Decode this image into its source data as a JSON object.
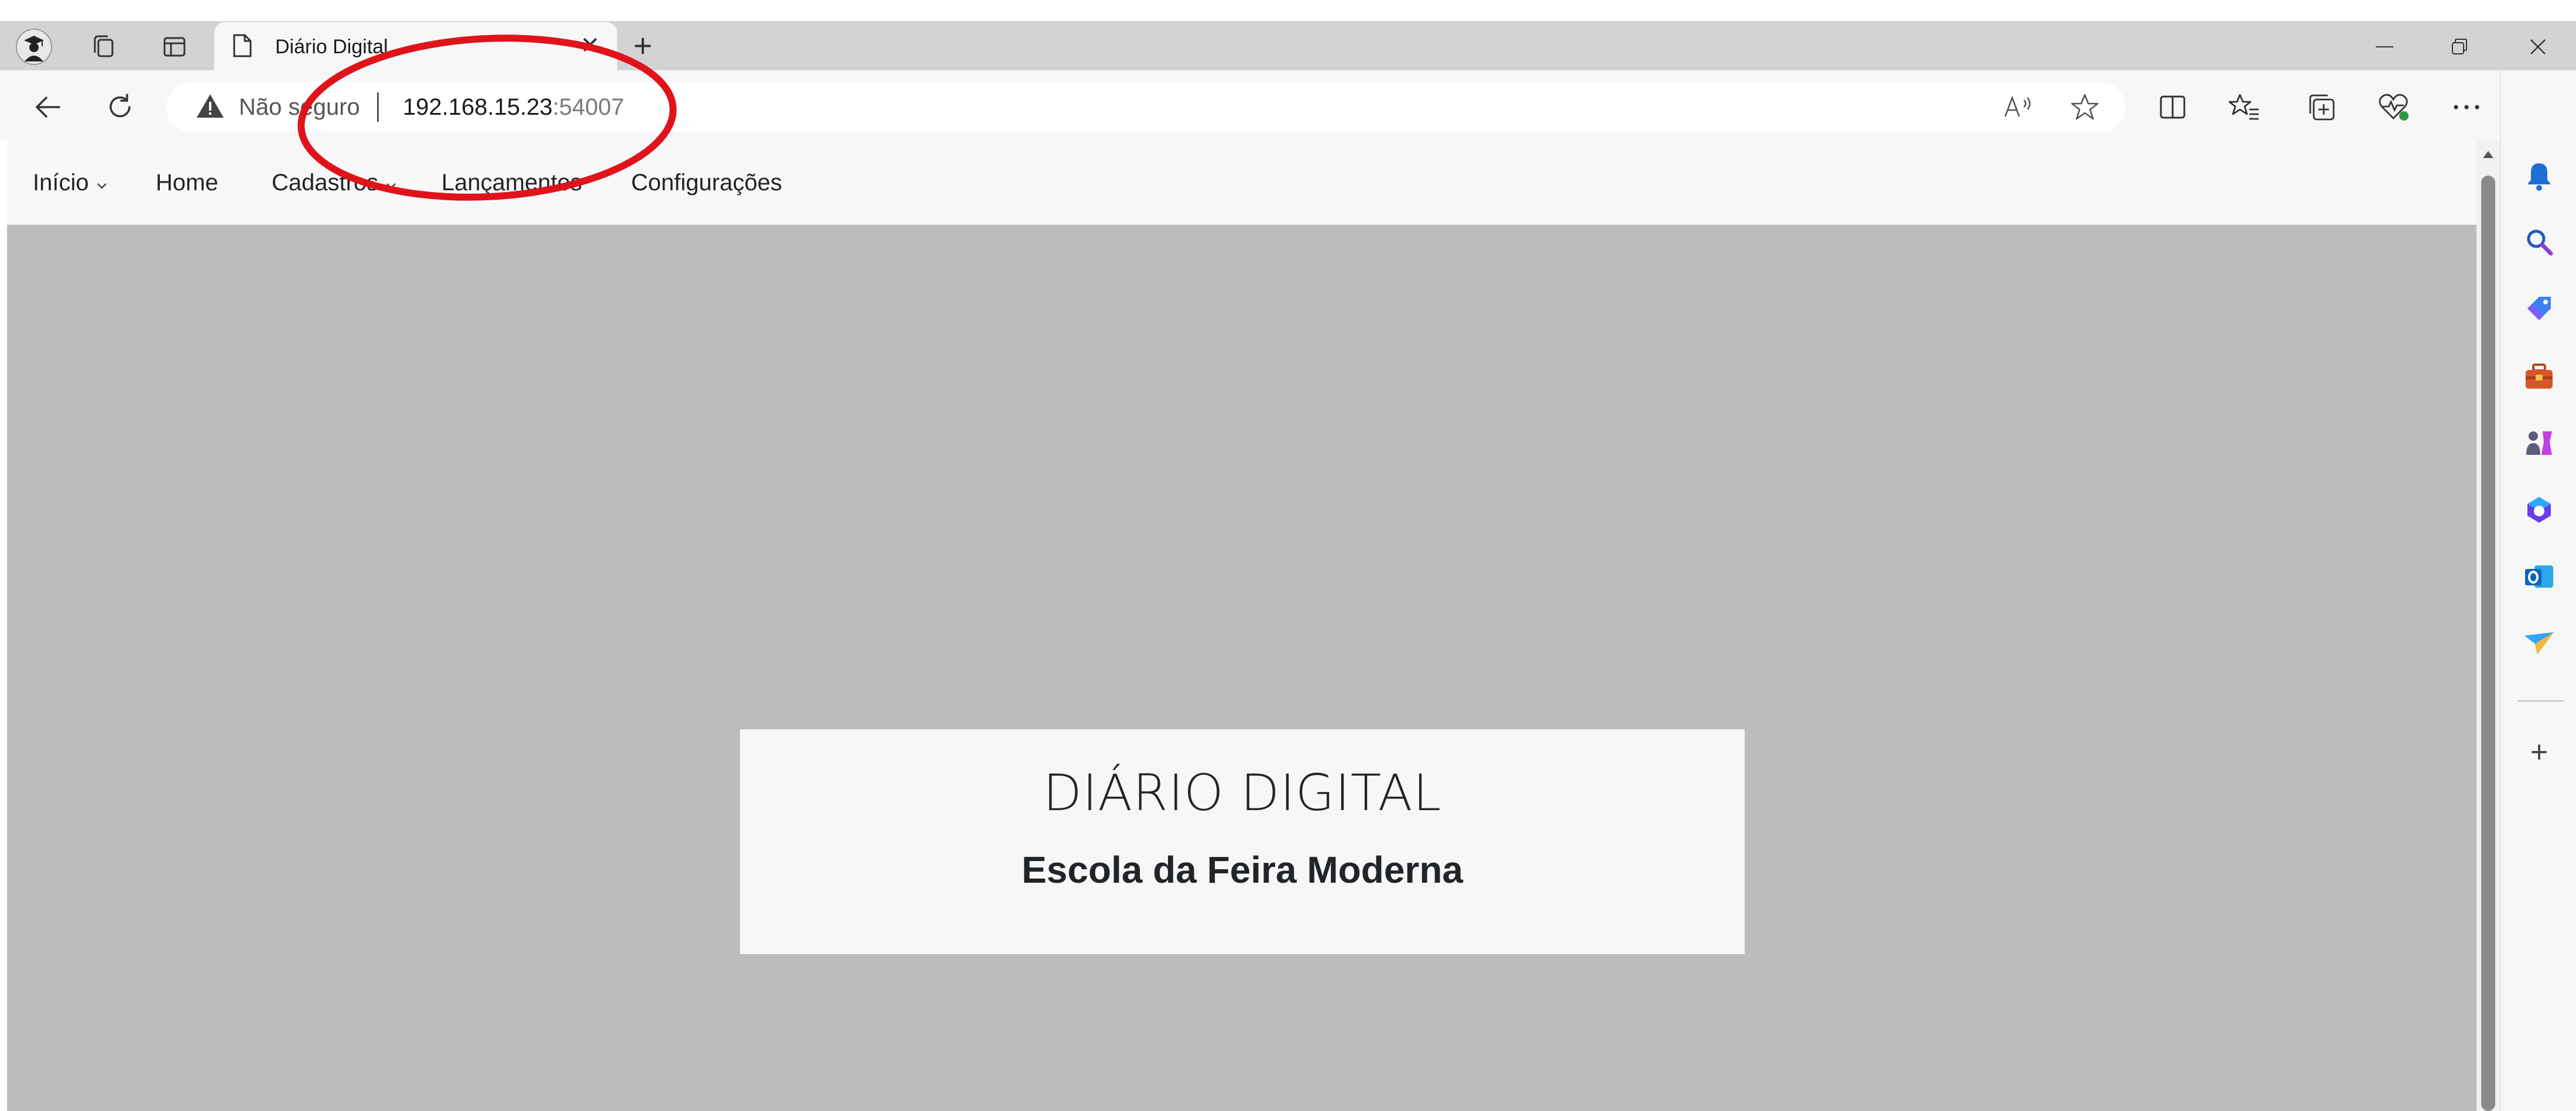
{
  "browser": {
    "tab": {
      "title": "Diário Digital",
      "close": "✕"
    },
    "new_tab": "+",
    "window_buttons": {
      "minimize": "—",
      "restore": "❐",
      "close": "✕"
    },
    "address": {
      "security_label": "Não seguro",
      "separator": "|",
      "url_host": "192.168.15.23",
      "url_port": ":54007"
    },
    "icons": {
      "profile": "profile-icon",
      "workspaces": "workspaces-icon",
      "tab-actions": "tab-actions-icon",
      "back": "back-arrow-icon",
      "refresh": "refresh-icon",
      "warning": "warning-triangle-icon",
      "read-aloud": "read-aloud-icon",
      "favorite": "star-icon",
      "split-screen": "split-screen-icon",
      "favorites": "favorites-icon",
      "collections": "collections-icon",
      "browser-essentials": "heart-pulse-icon",
      "more": "more-icon",
      "copilot": "copilot-icon"
    },
    "accent_colors": {
      "copilot": "#2b7de9",
      "annotation": "#e0131b"
    }
  },
  "nav": {
    "items": [
      {
        "label": "Início",
        "has_caret": true
      },
      {
        "label": "Home",
        "has_caret": false
      },
      {
        "label": "Cadastros",
        "has_caret": true
      },
      {
        "label": "Lançamentos",
        "has_caret": false
      },
      {
        "label": "Configurações",
        "has_caret": false
      }
    ]
  },
  "main": {
    "title": "DIÁRIO DIGITAL",
    "subtitle": "Escola da Feira Moderna"
  },
  "sidebar": {
    "icons": [
      "bell-icon",
      "search-icon",
      "shopping-tag-icon",
      "toolbox-icon",
      "games-icon",
      "microsoft365-icon",
      "outlook-icon",
      "send-icon"
    ],
    "add_label": "+"
  }
}
